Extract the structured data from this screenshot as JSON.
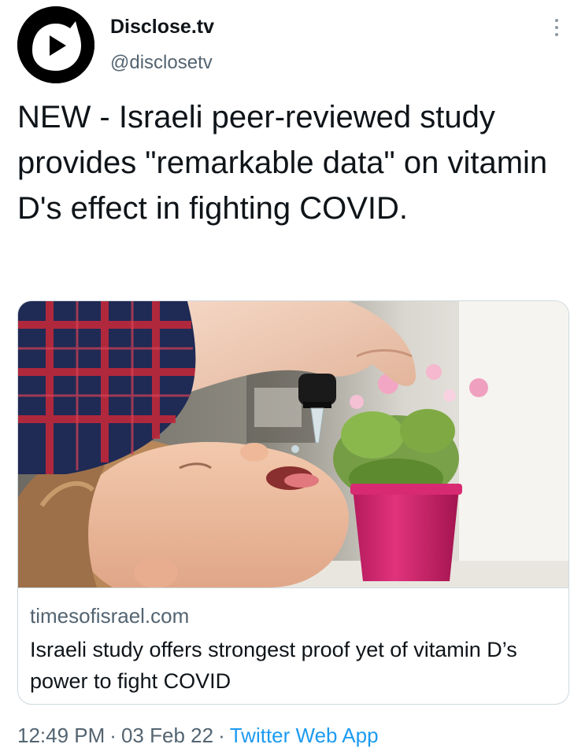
{
  "author": {
    "display_name": "Disclose.tv",
    "handle": "@disclosetv",
    "avatar_icon": "play-icon"
  },
  "menu": {
    "icon": "more-options-icon"
  },
  "tweet": {
    "text": "NEW - Israeli peer-reviewed study provides \"remarkable data\" on vitamin D's effect in fighting COVID."
  },
  "link_card": {
    "domain": "timesofisrael.com",
    "title": "Israeli study offers strongest proof yet of vitamin D’s power to fight COVID"
  },
  "footer": {
    "time": "12:49 PM",
    "separator": "·",
    "date": "03 Feb 22",
    "source": "Twitter Web App"
  },
  "colors": {
    "text": "#0f1419",
    "secondary_text": "#536471",
    "link": "#1d9bf0",
    "border": "#cfd9de"
  }
}
